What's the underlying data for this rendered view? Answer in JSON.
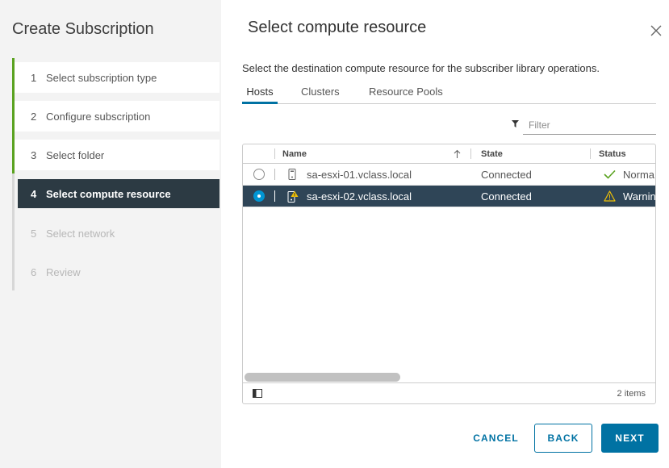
{
  "colors": {
    "primary": "#0072a3",
    "success": "#5aa220",
    "warning": "#efc006",
    "radio_selected": "#0095d3",
    "step_active_bg": "#2c3a43",
    "row_selected_bg": "#2f4557",
    "sidebar_bg": "#f3f3f3",
    "step_track_todo": "#d7d7d7"
  },
  "wizard": {
    "title": "Create Subscription",
    "current_step": 4,
    "steps": [
      {
        "number": "1",
        "label": "Select subscription type"
      },
      {
        "number": "2",
        "label": "Configure subscription"
      },
      {
        "number": "3",
        "label": "Select folder"
      },
      {
        "number": "4",
        "label": "Select compute resource"
      },
      {
        "number": "5",
        "label": "Select network"
      },
      {
        "number": "6",
        "label": "Review"
      }
    ]
  },
  "page": {
    "title": "Select compute resource",
    "close_icon": "close-icon",
    "description": "Select the destination compute resource for the subscriber library operations.",
    "active_tab": 0,
    "tabs": [
      {
        "label": "Hosts"
      },
      {
        "label": "Clusters"
      },
      {
        "label": "Resource Pools"
      }
    ],
    "filter": {
      "icon": "filter-icon",
      "placeholder": "Filter",
      "value": ""
    }
  },
  "grid": {
    "columns": {
      "name": "Name",
      "state": "State",
      "status": "Status"
    },
    "sort_icon": "sort-ascending-icon",
    "rows": [
      {
        "selected": false,
        "host_icon": "host-icon",
        "name": "sa-esxi-01.vclass.local",
        "state": "Connected",
        "status_icon": "check-icon",
        "status": "Norma"
      },
      {
        "selected": true,
        "host_icon": "host-warning-icon",
        "name": "sa-esxi-02.vclass.local",
        "state": "Connected",
        "status_icon": "warning-icon",
        "status": "Warnin"
      }
    ],
    "footer": {
      "column_toggle_icon": "column-toggle-icon",
      "count_label": "2 items"
    }
  },
  "buttons": {
    "cancel": "CANCEL",
    "back": "BACK",
    "next": "NEXT"
  }
}
